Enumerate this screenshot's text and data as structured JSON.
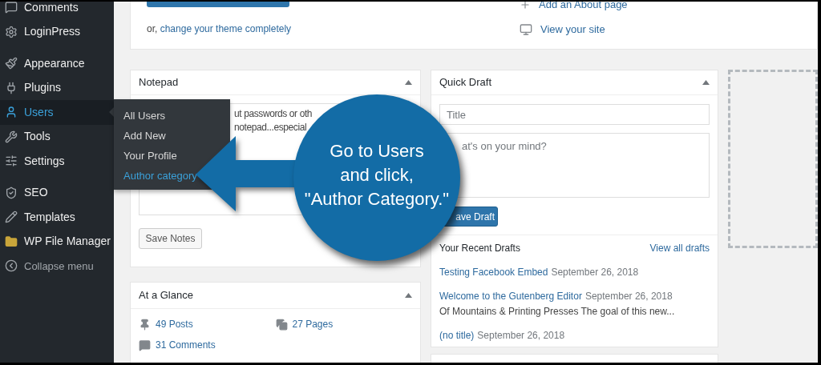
{
  "sidebar": {
    "items": [
      {
        "label": "Comments",
        "selected": false
      },
      {
        "label": "LoginPress",
        "selected": false
      },
      {
        "label": "Appearance",
        "selected": false
      },
      {
        "label": "Plugins",
        "selected": false
      },
      {
        "label": "Users",
        "selected": true
      },
      {
        "label": "Tools",
        "selected": false
      },
      {
        "label": "Settings",
        "selected": false
      },
      {
        "label": "SEO",
        "selected": false
      },
      {
        "label": "Templates",
        "selected": false
      },
      {
        "label": "WP File Manager",
        "selected": false
      },
      {
        "label": "Collapse menu",
        "selected": false
      }
    ]
  },
  "submenu": {
    "items": [
      {
        "label": "All Users",
        "selected": false
      },
      {
        "label": "Add New",
        "selected": false
      },
      {
        "label": "Your Profile",
        "selected": false
      },
      {
        "label": "Author category",
        "selected": true
      }
    ]
  },
  "welcome": {
    "change_theme_prefix": "or,",
    "change_theme_link": "change your theme completely",
    "links": [
      "Add an About page",
      "View your site"
    ]
  },
  "notepad": {
    "title": "Notepad",
    "text_lines": [
      "ut passwords or oth",
      "notepad...especial"
    ],
    "button": "Save Notes"
  },
  "at_a_glance": {
    "title": "At a Glance",
    "items": [
      "49 Posts",
      "27 Pages",
      "31 Comments"
    ]
  },
  "quick_draft": {
    "title": "Quick Draft",
    "title_placeholder": "Title",
    "content_placeholder": "at's on your mind?",
    "button": "ave Draft",
    "recent_title": "Your Recent Drafts",
    "view_all": "View all drafts",
    "drafts": [
      {
        "title": "Testing Facebook Embed",
        "date": "September 26, 2018"
      },
      {
        "title": "Welcome to the Gutenberg Editor",
        "date": "September 26, 2018",
        "excerpt": "Of Mountains & Printing Presses The goal of this new..."
      },
      {
        "title": "(no title)",
        "date": "September 26, 2018"
      }
    ]
  },
  "callout": {
    "lines": [
      "Go to Users",
      "and click,",
      "\"Author Category.\""
    ]
  }
}
